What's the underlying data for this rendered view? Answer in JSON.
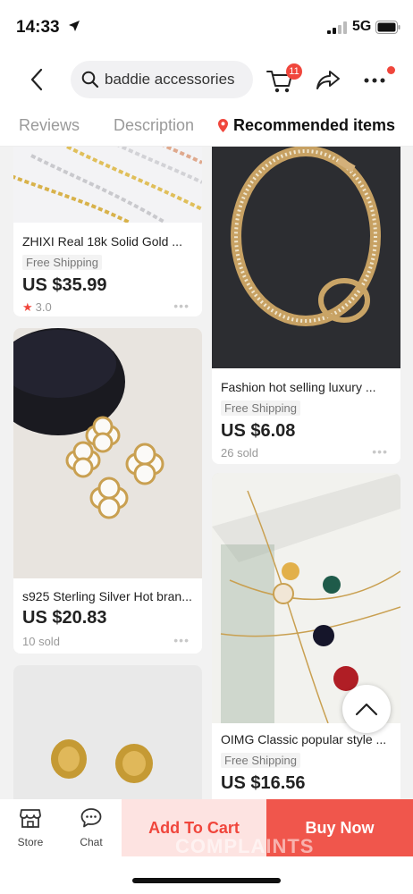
{
  "status_bar": {
    "time": "14:33",
    "network": "5G"
  },
  "header": {
    "search_text": "baddie accessories",
    "cart_badge": "11"
  },
  "tabs": [
    {
      "label": "Reviews"
    },
    {
      "label": "Description"
    },
    {
      "label": "Recommended items",
      "active": true
    }
  ],
  "products": [
    {
      "title": "ZHIXI Real 18k Solid Gold ...",
      "shipping": "Free Shipping",
      "price": "US $35.99",
      "rating": "3.0"
    },
    {
      "title": "Fashion hot selling luxury ...",
      "shipping": "Free Shipping",
      "price": "US $6.08",
      "sold": "26 sold"
    },
    {
      "title": "s925 Sterling Silver Hot bran...",
      "price": "US $20.83",
      "sold": "10 sold"
    },
    {
      "title": "OIMG Classic popular style ...",
      "shipping": "Free Shipping",
      "price": "US $16.56"
    }
  ],
  "bottom_bar": {
    "store_label": "Store",
    "chat_label": "Chat",
    "add_to_cart": "Add To Cart",
    "buy_now": "Buy Now",
    "watermark": "COMPLAINTS"
  },
  "colors": {
    "accent": "#f0463c",
    "buy_now_bg": "#f0564c",
    "add_cart_bg": "#fde3e1"
  }
}
